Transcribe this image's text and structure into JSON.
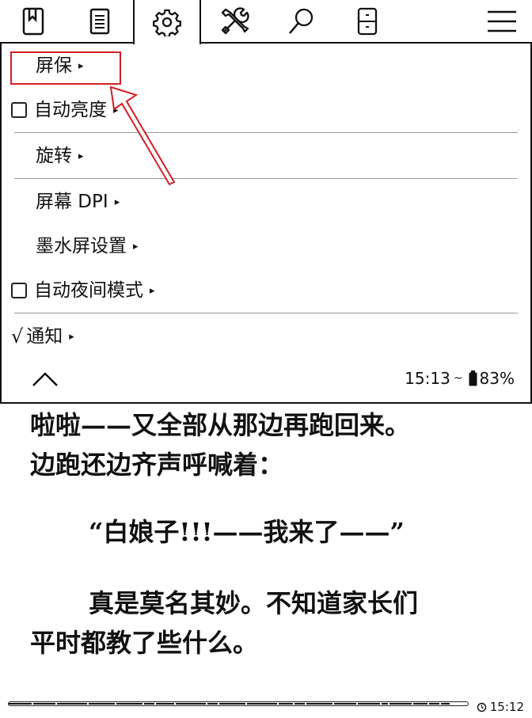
{
  "tabs": [
    {
      "icon": "bookmark-icon",
      "active": false
    },
    {
      "icon": "document-icon",
      "active": false
    },
    {
      "icon": "gear-icon",
      "active": true
    },
    {
      "icon": "tools-icon",
      "active": false
    },
    {
      "icon": "search-icon",
      "active": false
    },
    {
      "icon": "device-icon",
      "active": false
    },
    {
      "icon": "hamburger-menu-icon",
      "active": false
    }
  ],
  "menu": {
    "items": [
      {
        "label": "屏保",
        "type": "submenu",
        "checked": null
      },
      {
        "label": "自动亮度",
        "type": "checkbox-submenu",
        "checked": false
      },
      {
        "label": "旋转",
        "type": "submenu",
        "checked": null
      },
      {
        "label": "屏幕 DPI",
        "type": "submenu",
        "checked": null
      },
      {
        "label": "墨水屏设置",
        "type": "submenu",
        "checked": null
      },
      {
        "label": "自动夜间模式",
        "type": "checkbox-submenu",
        "checked": false
      },
      {
        "label": "通知",
        "type": "checkbox-submenu",
        "checked": true
      }
    ],
    "submenu_arrow": "▸",
    "checkmark": "√",
    "collapse_icon": "chevron-up-icon",
    "status": {
      "time": "15:13",
      "battery": "83%",
      "separator": "~"
    }
  },
  "reader": {
    "lines": [
      "啦啦——又全部从那边再跑回来。",
      "边跑还边齐声呼喊着：",
      "“白娘子!!!——我来了——”",
      "真是莫名其妙。不知道家长们",
      "平时都教了些什么。"
    ]
  },
  "footer": {
    "clock": "15:12",
    "progress": 0.96
  },
  "colors": {
    "highlight": "#d41f25",
    "ink": "#111111"
  }
}
